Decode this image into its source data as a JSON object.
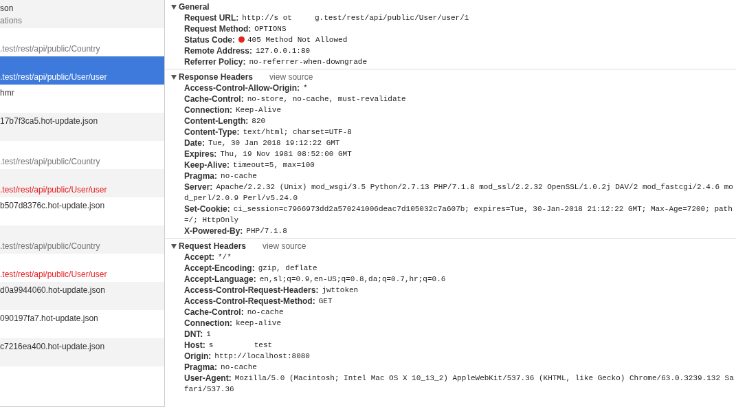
{
  "requests": [
    {
      "name": "son",
      "path": "ations",
      "selected": false,
      "failed": false
    },
    {
      "path": ".test/rest/api/public/Country",
      "selected": false,
      "failed": false
    },
    {
      "path": ".test/rest/api/public/User/user",
      "selected": true,
      "failed": true
    },
    {
      "name": "hmr",
      "selected": false,
      "failed": false
    },
    {
      "name": "17b7f3ca5.hot-update.json",
      "selected": false,
      "failed": false
    },
    {
      "path": ".test/rest/api/public/Country",
      "selected": false,
      "failed": false
    },
    {
      "path": ".test/rest/api/public/User/user",
      "selected": false,
      "failed": true
    },
    {
      "name": "b507d8376c.hot-update.json",
      "selected": false,
      "failed": false
    },
    {
      "path": ".test/rest/api/public/Country",
      "selected": false,
      "failed": false
    },
    {
      "path": ".test/rest/api/public/User/user",
      "selected": false,
      "failed": true
    },
    {
      "name": "d0a9944060.hot-update.json",
      "selected": false,
      "failed": false
    },
    {
      "name": "090197fa7.hot-update.json",
      "selected": false,
      "failed": false
    },
    {
      "name": "c7216ea400.hot-update.json",
      "selected": false,
      "failed": false
    }
  ],
  "sections": [
    {
      "title": "General",
      "expanded": true,
      "fields": [
        {
          "label": "Request URL:",
          "value": "http://s ot     g.test/rest/api/public/User/user/1"
        },
        {
          "label": "Request Method:",
          "value": "OPTIONS"
        },
        {
          "label": "Status Code:",
          "value": "405 Method Not Allowed",
          "color": "#e8231b"
        },
        {
          "label": "Remote Address:",
          "value": "127.0.0.1:80"
        },
        {
          "label": "Referrer Policy:",
          "value": "no-referrer-when-downgrade"
        }
      ]
    },
    {
      "title": "Response Headers",
      "link": "view source",
      "expanded": true,
      "fields": [
        {
          "label": "Access-Control-Allow-Origin:",
          "value": "*"
        },
        {
          "label": "Cache-Control:",
          "value": "no-store, no-cache, must-revalidate"
        },
        {
          "label": "Connection:",
          "value": "Keep-Alive"
        },
        {
          "label": "Content-Length:",
          "value": "820"
        },
        {
          "label": "Content-Type:",
          "value": "text/html; charset=UTF-8"
        },
        {
          "label": "Date:",
          "value": "Tue, 30 Jan 2018 19:12:22 GMT"
        },
        {
          "label": "Expires:",
          "value": "Thu, 19 Nov 1981 08:52:00 GMT"
        },
        {
          "label": "Keep-Alive:",
          "value": "timeout=5, max=100"
        },
        {
          "label": "Pragma:",
          "value": "no-cache"
        },
        {
          "label": "Server:",
          "value": "Apache/2.2.32 (Unix) mod_wsgi/3.5 Python/2.7.13 PHP/7.1.8 mod_ssl/2.2.32 OpenSSL/1.0.2j DAV/2 mod_fastcgi/2.4.6 mod_perl/2.0.9 Perl/v5.24.0"
        },
        {
          "label": "Set-Cookie:",
          "value": "ci_session=c7966973dd2a570241006deac7d105032c7a607b; expires=Tue, 30-Jan-2018 21:12:22 GMT; Max-Age=7200; path=/; HttpOnly"
        },
        {
          "label": "X-Powered-By:",
          "value": "PHP/7.1.8"
        }
      ]
    },
    {
      "title": "Request Headers",
      "link": "view source",
      "expanded": true,
      "fields": [
        {
          "label": "Accept:",
          "value": "*/*"
        },
        {
          "label": "Accept-Encoding:",
          "value": "gzip, deflate"
        },
        {
          "label": "Accept-Language:",
          "value": "en,sl;q=0.9,en-US;q=0.8,da;q=0.7,hr;q=0.6"
        },
        {
          "label": "Access-Control-Request-Headers:",
          "value": "jwttoken"
        },
        {
          "label": "Access-Control-Request-Method:",
          "value": "GET"
        },
        {
          "label": "Cache-Control:",
          "value": "no-cache"
        },
        {
          "label": "Connection:",
          "value": "keep-alive"
        },
        {
          "label": "DNT:",
          "value": "1"
        },
        {
          "label": "Host:",
          "value": "s         test"
        },
        {
          "label": "Origin:",
          "value": "http://localhost:8080"
        },
        {
          "label": "Pragma:",
          "value": "no-cache"
        },
        {
          "label": "User-Agent:",
          "value": "Mozilla/5.0 (Macintosh; Intel Mac OS X 10_13_2) AppleWebKit/537.36 (KHTML, like Gecko) Chrome/63.0.3239.132 Safari/537.36"
        }
      ]
    }
  ]
}
